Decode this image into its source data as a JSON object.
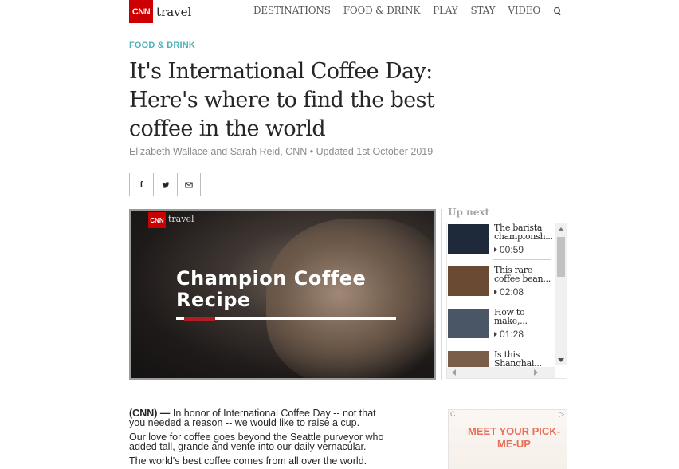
{
  "header": {
    "logo_text": "CNN",
    "brand_word": "travel",
    "nav": [
      "DESTINATIONS",
      "FOOD & DRINK",
      "PLAY",
      "STAY",
      "VIDEO"
    ]
  },
  "article": {
    "kicker": "FOOD & DRINK",
    "headline": "It's International Coffee Day: Here's where to find the best coffee in the world",
    "byline": "Elizabeth Wallace and Sarah Reid, CNN • Updated 1st October 2019"
  },
  "share": {
    "facebook": "f",
    "twitter_icon": "twitter-icon",
    "email_icon": "mail-icon"
  },
  "video": {
    "logo_text": "CNN",
    "brand_word": "travel",
    "title_line1": "Champion Coffee",
    "title_line2": "Recipe",
    "progress": 0.14
  },
  "up_next": {
    "label": "Up next",
    "items": [
      {
        "title": "The barista championsh...",
        "duration": "00:59",
        "thumb_color": "#1e2a3a"
      },
      {
        "title": "This rare coffee bean...",
        "duration": "02:08",
        "thumb_color": "#6b4a33"
      },
      {
        "title": "How to make,...",
        "duration": "01:28",
        "thumb_color": "#4a5566"
      },
      {
        "title": "Is this Shanghai...",
        "duration": "",
        "thumb_color": "#7a5e4a"
      }
    ]
  },
  "body": {
    "source": "(CNN) —",
    "p1": "In honor of International Coffee Day -- not that you needed a reason -- we would like to raise a cup.",
    "p2": "Our love for coffee goes beyond the Seattle purveyor who added tall, grande and vente into our daily vernacular.",
    "p3": "The world's best coffee comes from all over the world."
  },
  "ad": {
    "corner": "C",
    "adchoices": "▷",
    "text": "MEET YOUR PICK-ME-UP"
  },
  "colors": {
    "brand_red": "#cc0000",
    "kicker_teal": "#4bb3b8",
    "progress_red": "#b01e23",
    "ad_orange": "#e8705a"
  }
}
